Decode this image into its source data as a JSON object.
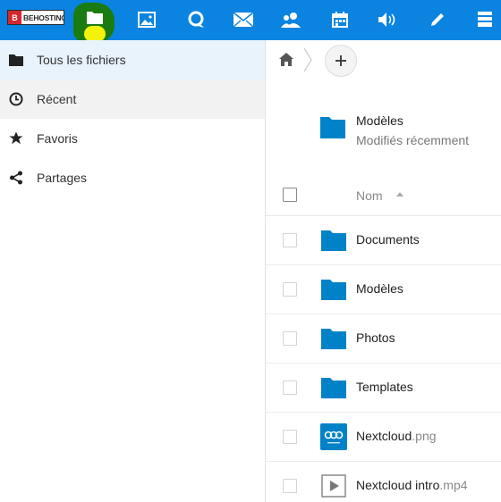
{
  "header": {
    "brand_mark": "B",
    "brand_text": "BEHOSTINGS",
    "apps": [
      {
        "name": "files",
        "icon": "folder-icon"
      },
      {
        "name": "photos",
        "icon": "image-icon"
      },
      {
        "name": "talk",
        "icon": "chat-bubble-icon"
      },
      {
        "name": "mail",
        "icon": "envelope-icon"
      },
      {
        "name": "contacts",
        "icon": "contacts-icon"
      },
      {
        "name": "calendar",
        "icon": "calendar-icon"
      },
      {
        "name": "audio",
        "icon": "speaker-icon"
      },
      {
        "name": "notes",
        "icon": "pencil-icon"
      },
      {
        "name": "deck",
        "icon": "stack-icon"
      }
    ],
    "color": "#0a84e0"
  },
  "sidebar": {
    "items": [
      {
        "label": "Tous les fichiers",
        "icon": "folder-icon",
        "state": "active"
      },
      {
        "label": "Récent",
        "icon": "clock-icon",
        "state": "hover"
      },
      {
        "label": "Favoris",
        "icon": "star-icon",
        "state": "normal"
      },
      {
        "label": "Partages",
        "icon": "share-icon",
        "state": "normal"
      }
    ]
  },
  "main": {
    "breadcrumb": {
      "home_icon": "home-icon",
      "add_icon": "plus-icon"
    },
    "recommended": {
      "name": "Modèles",
      "subtitle": "Modifiés récemment",
      "icon": "folder-icon"
    },
    "list_header": {
      "name_label": "Nom",
      "sort_icon": "sort-up-icon"
    },
    "files": [
      {
        "name": "Documents",
        "ext": "",
        "type": "folder"
      },
      {
        "name": "Modèles",
        "ext": "",
        "type": "folder"
      },
      {
        "name": "Photos",
        "ext": "",
        "type": "folder"
      },
      {
        "name": "Templates",
        "ext": "",
        "type": "folder"
      },
      {
        "name": "Nextcloud",
        "ext": ".png",
        "type": "image"
      },
      {
        "name": "Nextcloud intro",
        "ext": ".mp4",
        "type": "video"
      }
    ]
  },
  "colors": {
    "accent": "#0a84e0",
    "folder": "#0082c9",
    "active_bg": "#e8f3fc"
  }
}
